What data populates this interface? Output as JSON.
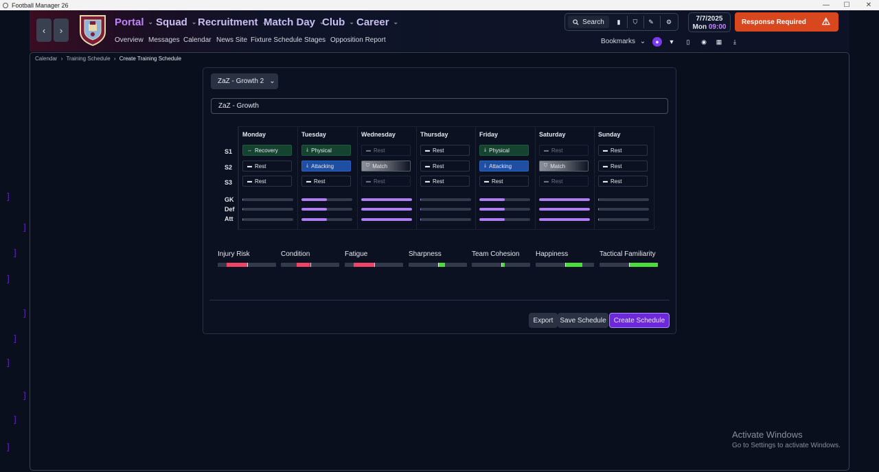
{
  "window": {
    "title": "Football Manager 26",
    "controls": [
      "—",
      "☐",
      "✕"
    ]
  },
  "nav": {
    "main": [
      {
        "label": "Portal",
        "active": true
      },
      {
        "label": "Squad",
        "active": false
      },
      {
        "label": "Recruitment",
        "active": false
      },
      {
        "label": "Match Day",
        "active": false
      },
      {
        "label": "Club",
        "active": false
      },
      {
        "label": "Career",
        "active": false
      }
    ],
    "sub": [
      "Overview",
      "Messages",
      "Calendar",
      "News Site",
      "Fixture Schedule",
      "Stages",
      "Opposition Report"
    ],
    "back_glyph": "‹",
    "forward_glyph": "›",
    "chevron": "⌄"
  },
  "toolbar": {
    "search_label": "Search",
    "date": "7/7/2025",
    "day": "Mon",
    "time": "09:00",
    "response_label": "Response Required",
    "bookmarks_label": "Bookmarks"
  },
  "breadcrumb": [
    "Calendar",
    "Training Schedule",
    "Create Training Schedule"
  ],
  "schedule": {
    "preset": "ZaZ - Growth 2",
    "name": "ZaZ - Growth",
    "days": [
      "Monday",
      "Tuesday",
      "Wednesday",
      "Thursday",
      "Friday",
      "Saturday",
      "Sunday"
    ],
    "session_labels": [
      "S1",
      "S2",
      "S3"
    ],
    "sessions": [
      [
        {
          "label": "Recovery",
          "type": "recovery"
        },
        {
          "label": "Rest",
          "type": "rest"
        },
        {
          "label": "Rest",
          "type": "rest"
        }
      ],
      [
        {
          "label": "Physical",
          "type": "physical"
        },
        {
          "label": "Attacking",
          "type": "attacking"
        },
        {
          "label": "Rest",
          "type": "rest"
        }
      ],
      [
        {
          "label": "Rest",
          "type": "dim"
        },
        {
          "label": "Match",
          "type": "match"
        },
        {
          "label": "Rest",
          "type": "dim"
        }
      ],
      [
        {
          "label": "Rest",
          "type": "rest"
        },
        {
          "label": "Rest",
          "type": "rest"
        },
        {
          "label": "Rest",
          "type": "rest"
        }
      ],
      [
        {
          "label": "Physical",
          "type": "physical"
        },
        {
          "label": "Attacking",
          "type": "attacking"
        },
        {
          "label": "Rest",
          "type": "rest"
        }
      ],
      [
        {
          "label": "Rest",
          "type": "dim"
        },
        {
          "label": "Match",
          "type": "match"
        },
        {
          "label": "Rest",
          "type": "dim"
        }
      ],
      [
        {
          "label": "Rest",
          "type": "rest"
        },
        {
          "label": "Rest",
          "type": "rest"
        },
        {
          "label": "Rest",
          "type": "rest"
        }
      ]
    ],
    "load_labels": [
      "GK",
      "Def",
      "Att"
    ],
    "load_levels": [
      [
        0.02,
        0.02,
        0.02
      ],
      [
        0.5,
        0.5,
        0.5
      ],
      [
        1.0,
        1.0,
        1.0
      ],
      [
        0.02,
        0.02,
        0.02
      ],
      [
        0.5,
        0.5,
        0.5
      ],
      [
        1.0,
        1.0,
        1.0
      ],
      [
        0.02,
        0.02,
        0.02
      ]
    ]
  },
  "metrics": [
    {
      "label": "Injury Risk",
      "from": 0.15,
      "to": 0.5,
      "color": "#ef4466"
    },
    {
      "label": "Condition",
      "from": 0.27,
      "to": 0.5,
      "color": "#ef4466"
    },
    {
      "label": "Fatigue",
      "from": 0.15,
      "to": 0.5,
      "color": "#ef4466"
    },
    {
      "label": "Sharpness",
      "from": 0.5,
      "to": 0.62,
      "color": "#4ade3a"
    },
    {
      "label": "Team Cohesion",
      "from": 0.5,
      "to": 0.57,
      "color": "#4ade3a"
    },
    {
      "label": "Happiness",
      "from": 0.5,
      "to": 0.8,
      "color": "#4ade3a"
    },
    {
      "label": "Tactical Familiarity",
      "from": 0.5,
      "to": 1.0,
      "color": "#4ade3a"
    }
  ],
  "actions": {
    "export": "Export",
    "save": "Save Schedule",
    "create": "Create Schedule"
  },
  "watermark": {
    "line1": "Activate Windows",
    "line2": "Go to Settings to activate Windows."
  }
}
